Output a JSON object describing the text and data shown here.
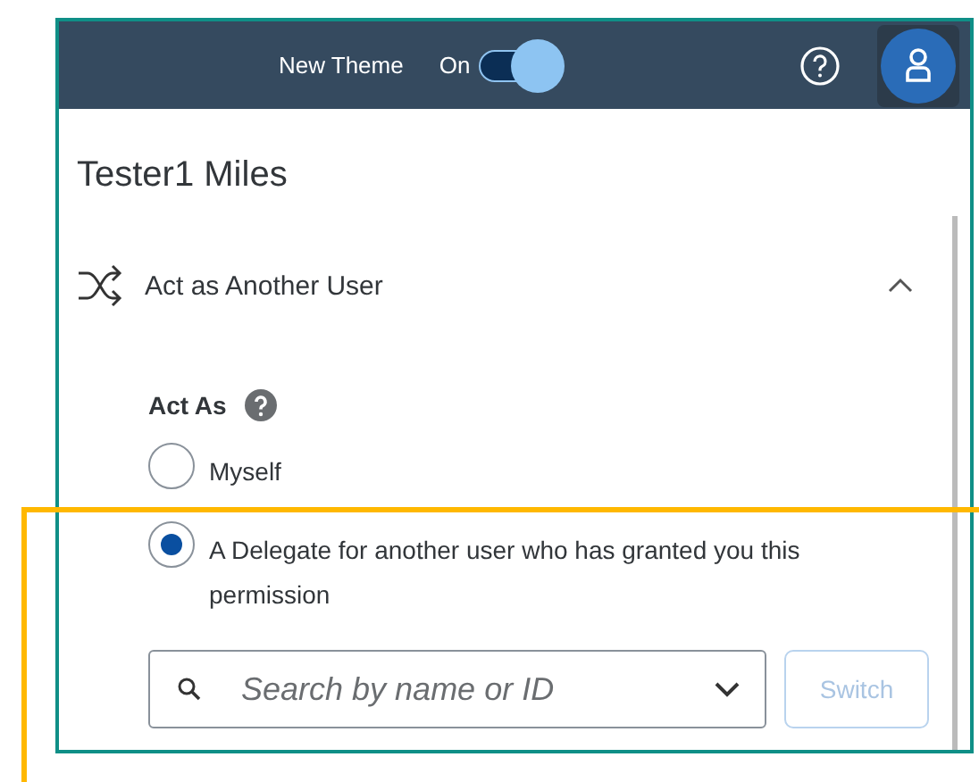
{
  "header": {
    "theme_label": "New Theme",
    "toggle": {
      "label": "On",
      "on": true
    }
  },
  "user_name": "Tester1 Miles",
  "section": {
    "title": "Act as Another User",
    "expanded": true
  },
  "act_as": {
    "label": "Act As",
    "options": [
      {
        "label": "Myself",
        "selected": false
      },
      {
        "label": "A Delegate for another user who has granted you this permission",
        "selected": true
      }
    ]
  },
  "search": {
    "placeholder": "Search by name or ID"
  },
  "switch_button": {
    "label": "Switch",
    "disabled": true
  }
}
